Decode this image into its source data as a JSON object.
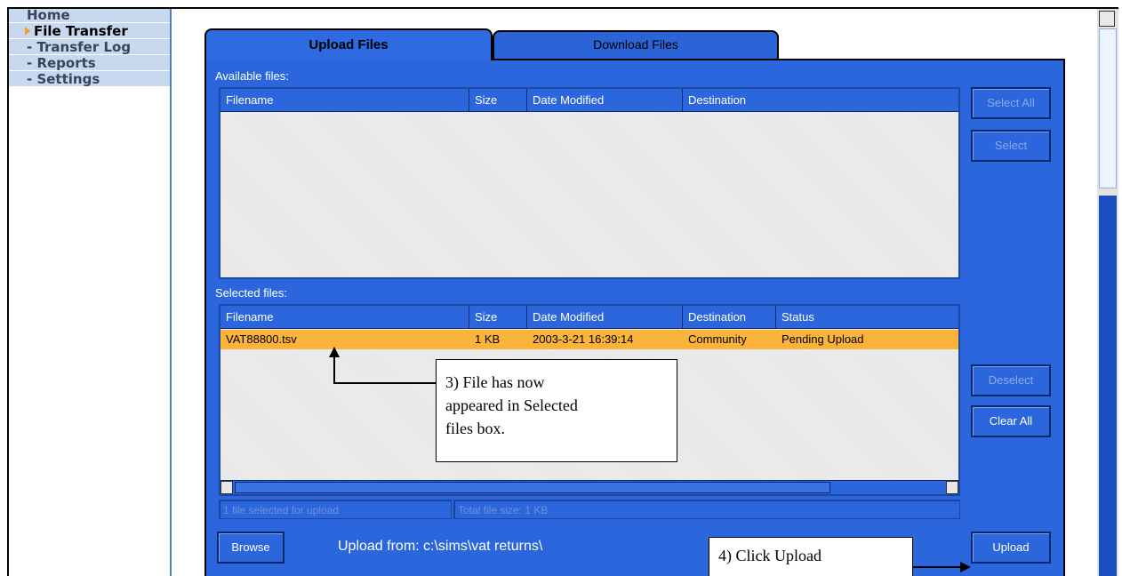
{
  "sidebar": {
    "items": [
      {
        "label": "Home"
      },
      {
        "label": "File Transfer"
      },
      {
        "label": "- Transfer Log"
      },
      {
        "label": "- Reports"
      },
      {
        "label": "- Settings"
      }
    ]
  },
  "tabs": {
    "upload": "Upload Files",
    "download": "Download Files"
  },
  "available": {
    "label": "Available files:",
    "columns": [
      "Filename",
      "Size",
      "Date Modified",
      "Destination"
    ]
  },
  "selected": {
    "label": "Selected files:",
    "columns": [
      "Filename",
      "Size",
      "Date Modified",
      "Destination",
      "Status"
    ],
    "rows": [
      {
        "filename": "VAT88800.tsv",
        "size": "1 KB",
        "date": "2003-3-21 16:39:14",
        "destination": "Community",
        "status": "Pending Upload"
      }
    ]
  },
  "buttons": {
    "select_all": "Select All",
    "select": "Select",
    "deselect": "Deselect",
    "clear_all": "Clear All",
    "browse": "Browse",
    "upload": "Upload"
  },
  "status": {
    "selected_count": "1 file selected for upload",
    "total_size": "Total file size:  1 KB"
  },
  "upload_from": "Upload from: c:\\sims\\vat returns\\",
  "callouts": {
    "step3_line1": "3) File has now",
    "step3_line2": "appeared in Selected",
    "step3_line3": "files box.",
    "step4": "4) Click Upload"
  },
  "colors": {
    "panel": "#2c66dc",
    "highlight_row": "#fbb33a",
    "sidebar": "#c8d8ef",
    "active_arrow": "#f3a117"
  },
  "icons": {
    "active": "arrow-right-icon"
  }
}
